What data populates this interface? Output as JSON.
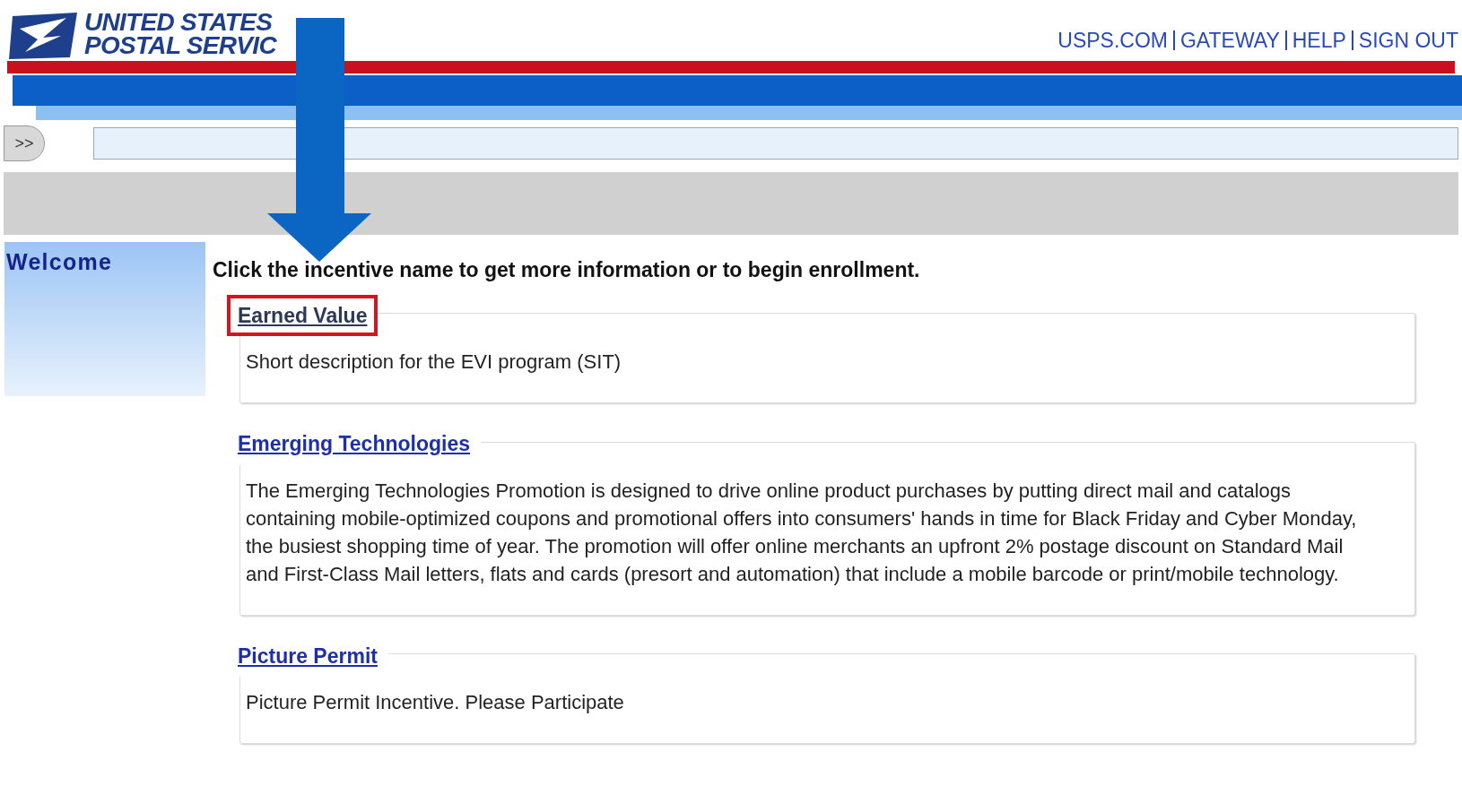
{
  "logo": {
    "line_1": "UNITED STATES",
    "line_2": "POSTAL SERVIC"
  },
  "top_links": [
    "USPS.COM",
    "GATEWAY",
    "HELP",
    "SIGN OUT"
  ],
  "expand_button": ">>",
  "sidebar": {
    "title": "Welcome"
  },
  "instruction": "Click the incentive name to get more information or to begin enrollment.",
  "incentives": [
    {
      "name": "Earned Value",
      "visited": true,
      "highlighted": true,
      "description": "Short description for the EVI program (SIT)"
    },
    {
      "name": "Emerging Technologies",
      "visited": false,
      "highlighted": false,
      "description": "The Emerging Technologies Promotion is designed to drive online product purchases by putting direct mail and catalogs containing mobile-optimized coupons and promotional offers into consumers' hands in time for Black Friday and Cyber Monday, the busiest shopping time of year. The promotion will offer online merchants  an upfront 2% postage discount on Standard Mail and First-Class  Mail letters, flats and cards (presort and automation) that include a mobile barcode or print/mobile technology."
    },
    {
      "name": "Picture Permit",
      "visited": false,
      "highlighted": false,
      "description": "Picture Permit Incentive. Please Participate"
    }
  ]
}
